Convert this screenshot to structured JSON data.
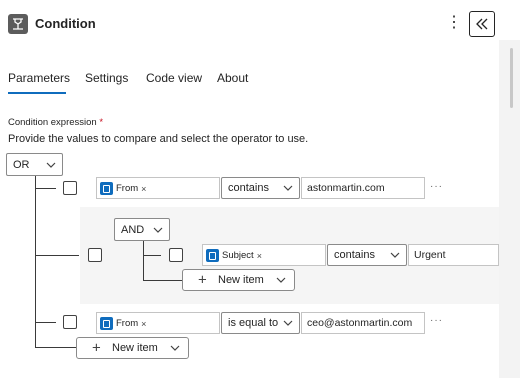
{
  "header": {
    "title": "Condition",
    "icon": "condition-icon",
    "more_glyph": "⋮"
  },
  "tabs": [
    {
      "label": "Parameters",
      "active": true
    },
    {
      "label": "Settings",
      "active": false
    },
    {
      "label": "Code view",
      "active": false
    },
    {
      "label": "About",
      "active": false
    }
  ],
  "condition": {
    "label": "Condition expression",
    "required_mark": "*",
    "description": "Provide the values to compare and select the operator to use.",
    "root_operator": "OR",
    "row1": {
      "token": "From",
      "token_close": "×",
      "operator": "contains",
      "value": "astonmartin.com",
      "ellipsis": "···"
    },
    "group": {
      "operator": "AND",
      "row": {
        "token": "Subject",
        "token_close": "×",
        "operator": "contains",
        "value": "Urgent"
      },
      "new_item": "New item"
    },
    "row3": {
      "token": "From",
      "token_close": "×",
      "operator": "is equal to",
      "value": "ceo@astonmartin.com",
      "ellipsis": "···"
    },
    "new_item": "New item",
    "plus_glyph": "+"
  },
  "colors": {
    "accent": "#0f6cbd",
    "outlook": "#0f6cbd",
    "required": "#c50f1f"
  }
}
